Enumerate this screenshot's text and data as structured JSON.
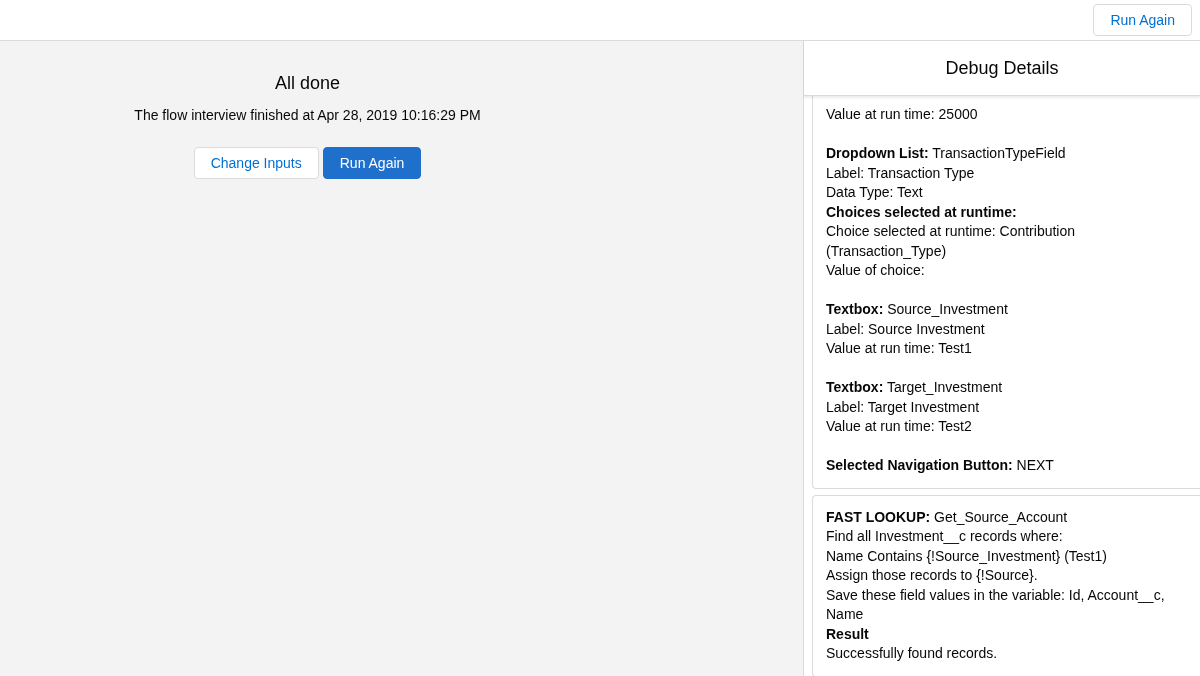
{
  "top_bar": {
    "button": "Run Again"
  },
  "result": {
    "title": "All done",
    "message": "The flow interview finished at Apr 28, 2019 10:16:29 PM",
    "buttons": [
      {
        "label": "Change Inputs",
        "kind": "neutral"
      },
      {
        "label": "Run Again",
        "kind": "brand"
      }
    ]
  },
  "debug_panel": {
    "title": "Debug Details",
    "cards": [
      {
        "blocks": [
          [
            {
              "text": "Value at run time: 25000",
              "bold": false
            }
          ],
          [
            {
              "text": "**Dropdown List:** TransactionTypeField",
              "bold": false
            },
            {
              "text": "Label: Transaction Type",
              "bold": false
            },
            {
              "text": "Data Type: Text",
              "bold": false
            },
            {
              "text": "Choices selected at runtime:",
              "bold": true
            },
            {
              "text": "Choice selected at runtime: Contribution (Transaction_Type)",
              "bold": false
            },
            {
              "text": "Value of choice:",
              "bold": false
            }
          ],
          [
            {
              "text": "**Textbox:** Source_Investment",
              "bold": false
            },
            {
              "text": "Label: Source Investment",
              "bold": false
            },
            {
              "text": "Value at run time: Test1",
              "bold": false
            }
          ],
          [
            {
              "text": "**Textbox:** Target_Investment",
              "bold": false
            },
            {
              "text": "Label: Target Investment",
              "bold": false
            },
            {
              "text": "Value at run time: Test2",
              "bold": false
            }
          ],
          [
            {
              "text": "**Selected Navigation Button:** NEXT",
              "bold": false
            }
          ]
        ]
      },
      {
        "blocks": [
          [
            {
              "text": "**FAST LOOKUP:** Get_Source_Account",
              "bold": false
            },
            {
              "text": "Find all Investment__c records where:",
              "bold": false
            },
            {
              "text": "Name Contains {!Source_Investment} (Test1)",
              "bold": false
            },
            {
              "text": "Assign those records to {!Source}.",
              "bold": false
            },
            {
              "text": "Save these field values in the variable: Id, Account__c, Name",
              "bold": false
            },
            {
              "text": "Result",
              "bold": true
            },
            {
              "text": "Successfully found records.",
              "bold": false
            }
          ]
        ]
      }
    ]
  }
}
